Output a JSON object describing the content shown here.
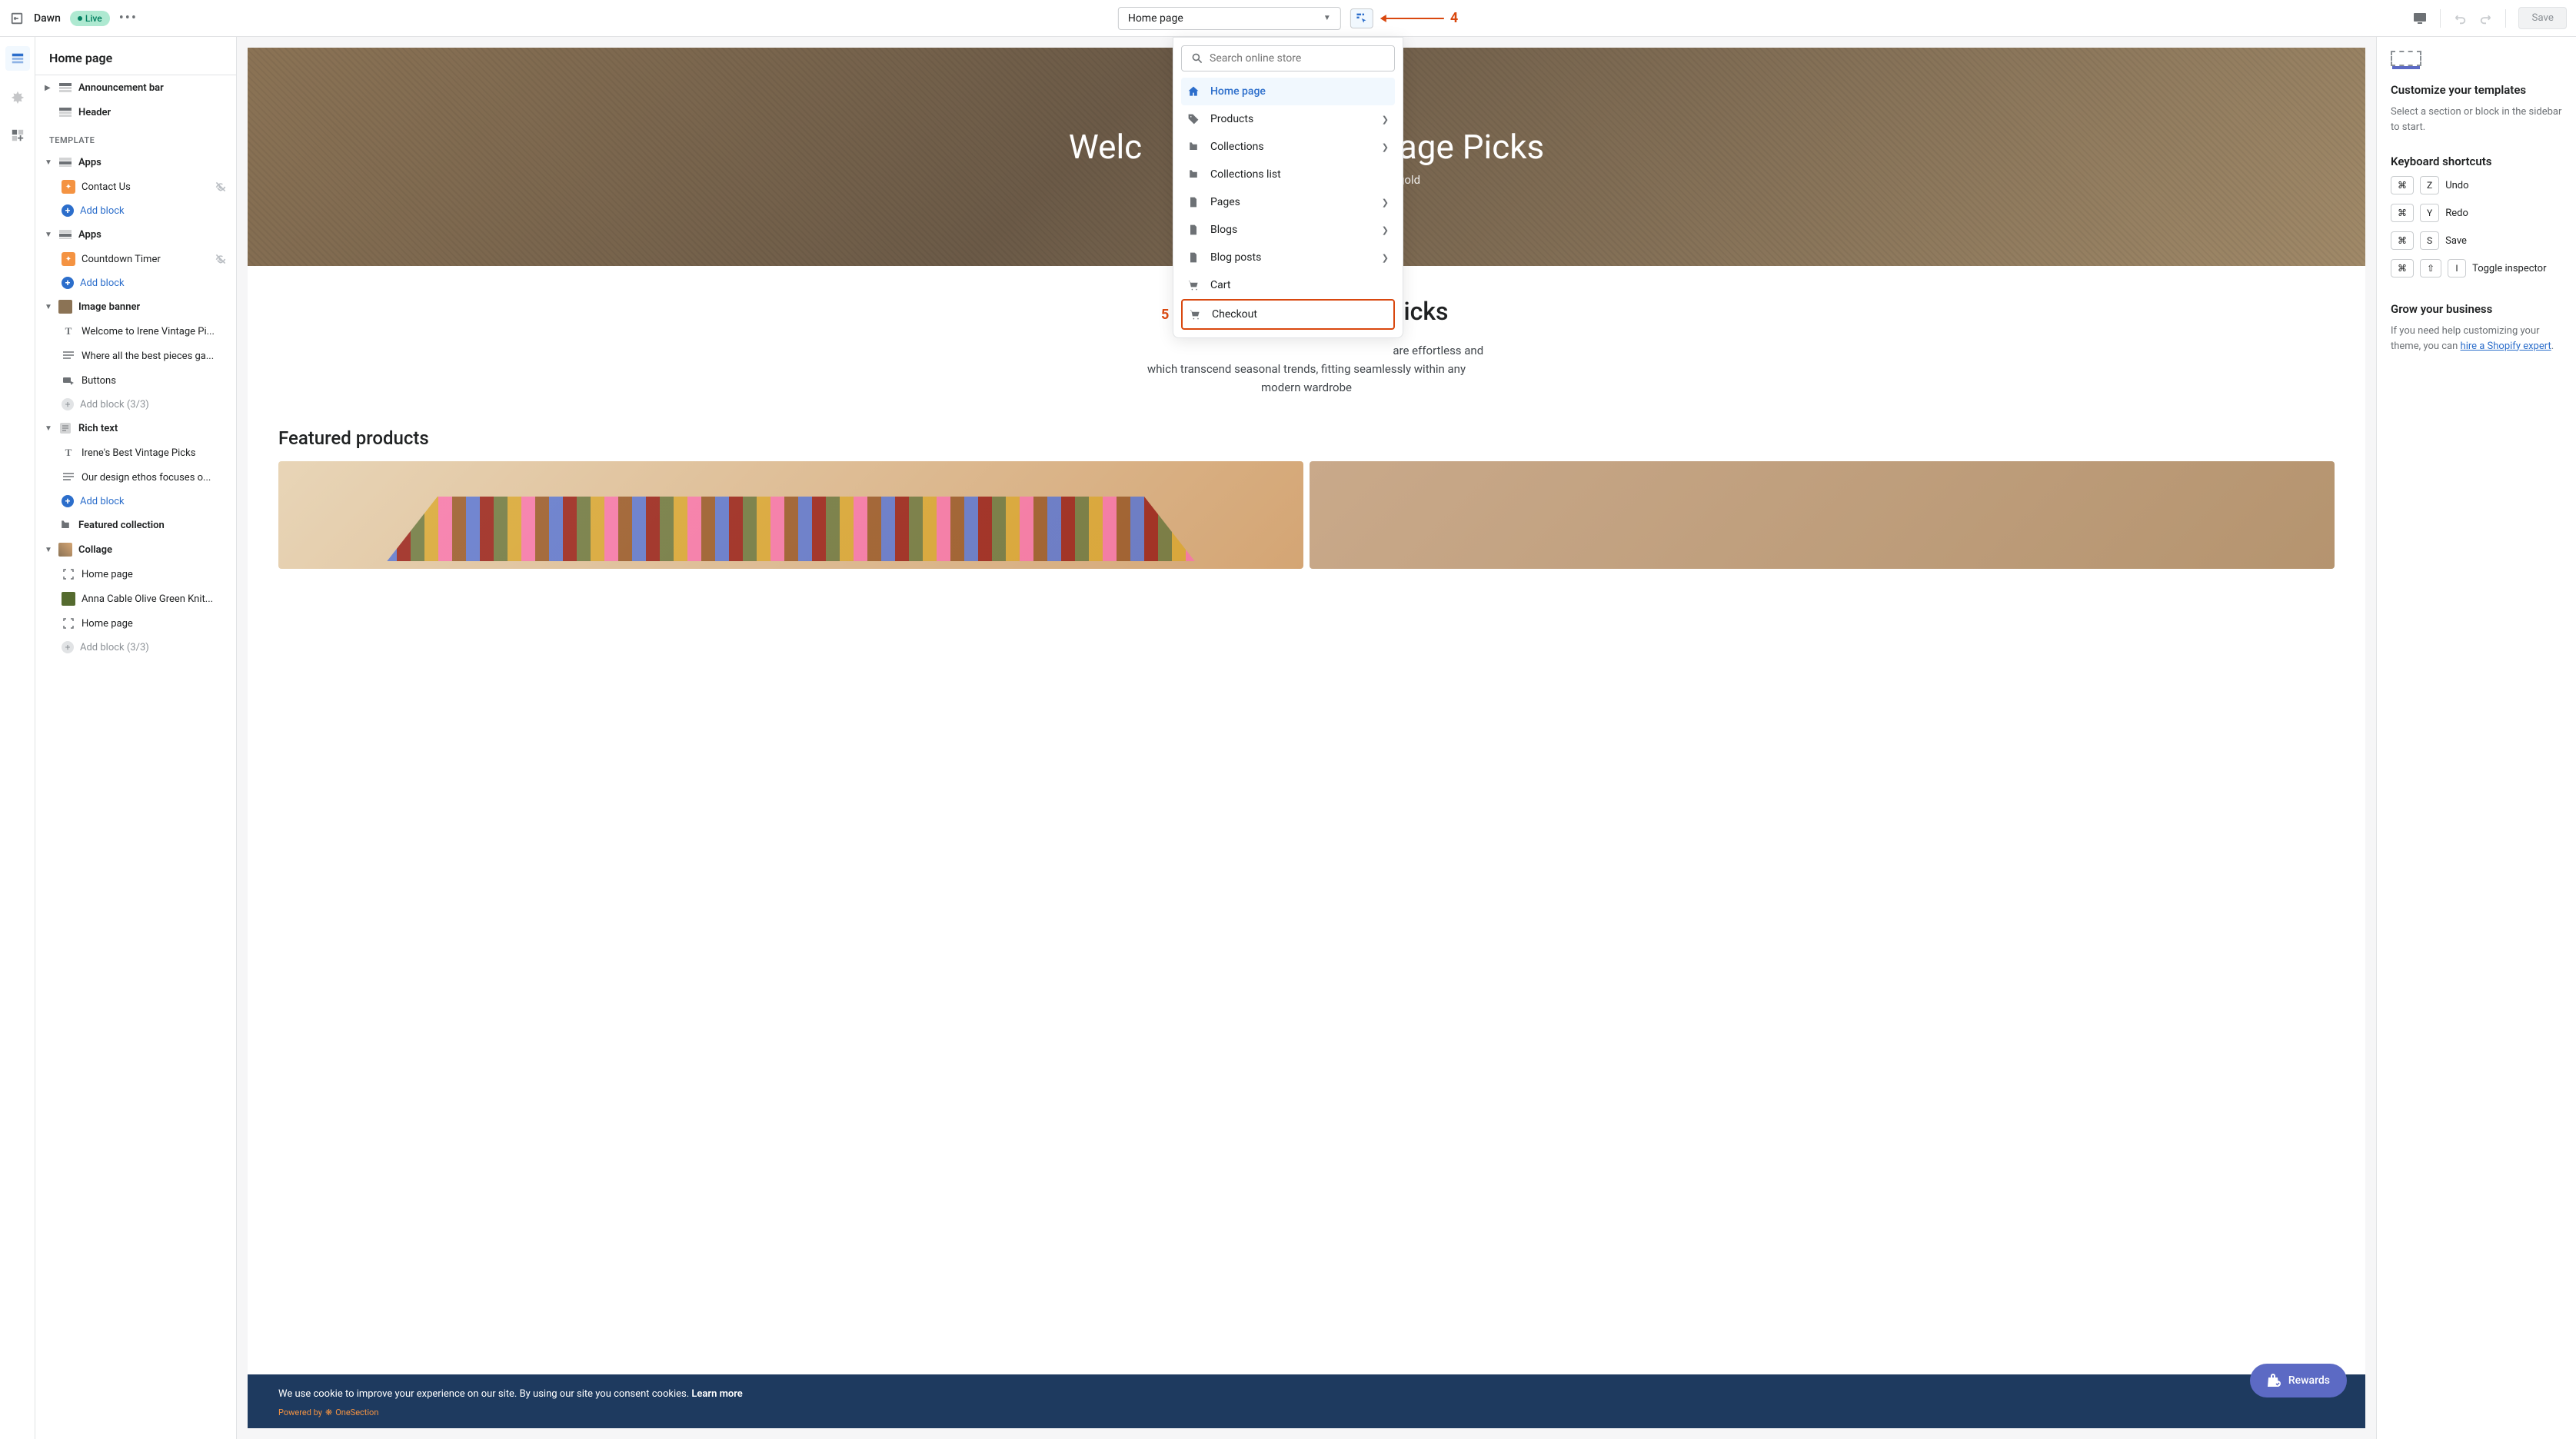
{
  "topbar": {
    "theme_name": "Dawn",
    "live_label": "Live",
    "page_select_value": "Home page",
    "save_label": "Save",
    "annotation_4": "4"
  },
  "dropdown": {
    "search_placeholder": "Search online store",
    "items": [
      {
        "label": "Home page",
        "has_chevron": false,
        "active": true
      },
      {
        "label": "Products",
        "has_chevron": true
      },
      {
        "label": "Collections",
        "has_chevron": true
      },
      {
        "label": "Collections list",
        "has_chevron": false
      },
      {
        "label": "Pages",
        "has_chevron": true
      },
      {
        "label": "Blogs",
        "has_chevron": true
      },
      {
        "label": "Blog posts",
        "has_chevron": true
      },
      {
        "label": "Cart",
        "has_chevron": false
      },
      {
        "label": "Checkout",
        "has_chevron": false,
        "highlight": true
      }
    ],
    "annotation_5": "5"
  },
  "sidebar": {
    "title": "Home page",
    "announcement": "Announcement bar",
    "header": "Header",
    "template_heading": "TEMPLATE",
    "apps1_label": "Apps",
    "contact_us": "Contact Us",
    "add_block": "Add block",
    "apps2_label": "Apps",
    "countdown": "Countdown Timer",
    "image_banner": "Image banner",
    "welcome_block": "Welcome to Irene Vintage Pi...",
    "where_block": "Where all the best pieces ga...",
    "buttons_block": "Buttons",
    "add_block_disabled": "Add block (3/3)",
    "rich_text": "Rich text",
    "irene_best": "Irene's Best Vintage Picks",
    "design_ethos": "Our design ethos focuses o...",
    "featured_collection": "Featured collection",
    "collage": "Collage",
    "home_page_1": "Home page",
    "anna_cable": "Anna Cable Olive Green Knit...",
    "home_page_2": "Home page"
  },
  "preview": {
    "hero_title_left": "Welc",
    "hero_title_right": "tage Picks",
    "hero_sub_right": "t gold",
    "content_title_right": "e Picks",
    "content_line1_right": "are effortless and",
    "content_line2": "which transcend seasonal trends, fitting seamlessly within any",
    "content_line3": "modern wardrobe",
    "featured_label": "Featured products",
    "cookie_text": "We use cookie to improve your experience on our site. By using our site you consent cookies. ",
    "cookie_link": "Learn more",
    "cookie_powered": "Powered by",
    "cookie_brand": "OneSection",
    "rewards_label": "Rewards"
  },
  "rightbar": {
    "customize_title": "Customize your templates",
    "customize_text": "Select a section or block in the sidebar to start.",
    "shortcuts_title": "Keyboard shortcuts",
    "shortcuts": [
      {
        "keys": [
          "⌘",
          "Z"
        ],
        "label": "Undo"
      },
      {
        "keys": [
          "⌘",
          "Y"
        ],
        "label": "Redo"
      },
      {
        "keys": [
          "⌘",
          "S"
        ],
        "label": "Save"
      },
      {
        "keys": [
          "⌘",
          "⇧",
          "I"
        ],
        "label": "Toggle inspector"
      }
    ],
    "grow_title": "Grow your business",
    "grow_text_1": "If you need help customizing your theme, you can ",
    "grow_link": "hire a Shopify expert",
    "grow_text_2": "."
  }
}
